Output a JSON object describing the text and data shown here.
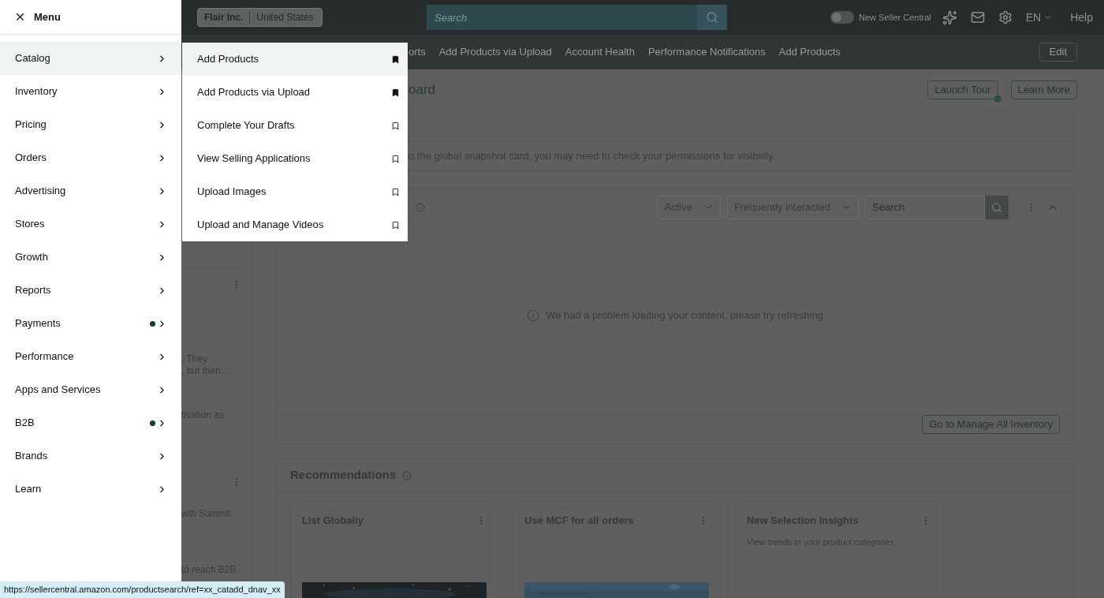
{
  "top_bar": {
    "account": {
      "company": "Flair Inc.",
      "country": "United States"
    },
    "search": {
      "placeholder": "Search"
    },
    "new_seller_central": {
      "label": "New Seller Central",
      "on": false
    },
    "language": "EN",
    "help": "Help"
  },
  "nav": {
    "items": [
      "orts",
      "Add Products via Upload",
      "Account Health",
      "Performance Notifications",
      "Add Products"
    ],
    "edit": "Edit"
  },
  "dashboard": {
    "title": "oard",
    "buttons": [
      "Launch Tour",
      "Learn More"
    ],
    "notice": "o the global snapshot card, you may need to check your permissions for visibility.",
    "inventory_card": {
      "filters": [
        "Active",
        "Frequently interacted"
      ],
      "search": {
        "placeholder": "Search"
      },
      "expanded": true,
      "error": "We had a problem loading your content, please try refreshing",
      "action": "Go to Manage All Inventory"
    },
    "recommendations": {
      "title": "Recommendations",
      "cards": [
        {
          "title": "List Globally",
          "kind": "picture"
        },
        {
          "title": "Use MCF for all orders",
          "kind": "picture"
        },
        {
          "title": "New Selection Insights",
          "kind": "text",
          "description": "View trends in your product categories"
        }
      ]
    }
  },
  "side_cards": [
    {
      "lines": [
        ". They",
        ", but then…"
      ],
      "extra": "tivation as"
    },
    {
      "lines": [
        "wth Summit"
      ],
      "extra": "to reach B2B"
    }
  ],
  "menu": {
    "title": "Menu",
    "items": [
      {
        "label": "Catalog",
        "selected": true,
        "dot": false
      },
      {
        "label": "Inventory",
        "selected": false,
        "dot": false
      },
      {
        "label": "Pricing",
        "selected": false,
        "dot": false
      },
      {
        "label": "Orders",
        "selected": false,
        "dot": false
      },
      {
        "label": "Advertising",
        "selected": false,
        "dot": false
      },
      {
        "label": "Stores",
        "selected": false,
        "dot": false
      },
      {
        "label": "Growth",
        "selected": false,
        "dot": false
      },
      {
        "label": "Reports",
        "selected": false,
        "dot": false
      },
      {
        "label": "Payments",
        "selected": false,
        "dot": true
      },
      {
        "label": "Performance",
        "selected": false,
        "dot": false
      },
      {
        "label": "Apps and Services",
        "selected": false,
        "dot": false
      },
      {
        "label": "B2B",
        "selected": false,
        "dot": true
      },
      {
        "label": "Brands",
        "selected": false,
        "dot": false
      },
      {
        "label": "Learn",
        "selected": false,
        "dot": false
      }
    ]
  },
  "submenu": {
    "items": [
      {
        "label": "Add Products",
        "selected": true,
        "bookmarked": true
      },
      {
        "label": "Add Products via Upload",
        "selected": false,
        "bookmarked": true
      },
      {
        "label": "Complete Your Drafts",
        "selected": false,
        "bookmarked": false
      },
      {
        "label": "View Selling Applications",
        "selected": false,
        "bookmarked": false
      },
      {
        "label": "Upload Images",
        "selected": false,
        "bookmarked": false
      },
      {
        "label": "Upload and Manage Videos",
        "selected": false,
        "bookmarked": false
      }
    ]
  },
  "status_bar": "https://sellercentral.amazon.com/productsearch/ref=xx_catadd_dnav_xx"
}
